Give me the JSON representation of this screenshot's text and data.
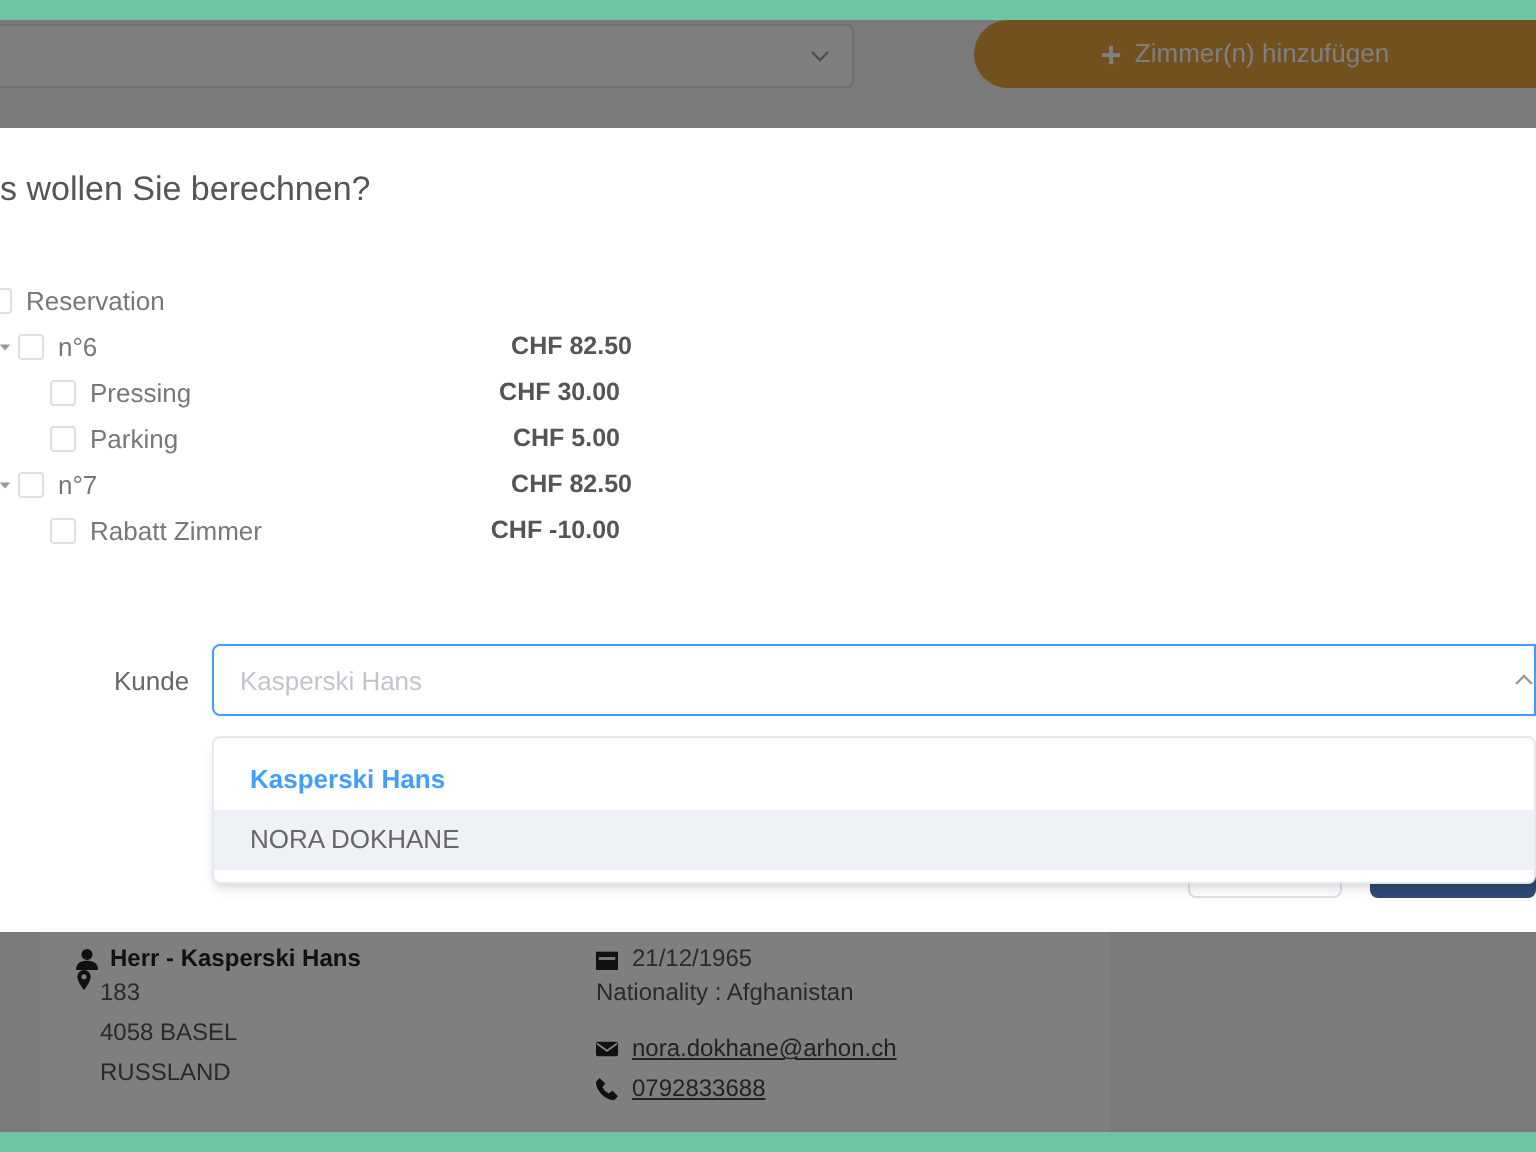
{
  "background": {
    "add_button": {
      "label": "Zimmer(n) hinzufügen"
    },
    "customer_card": {
      "name": "Herr - Kasperski Hans",
      "address": [
        "183",
        "4058 BASEL",
        "RUSSLAND"
      ],
      "birthdate": "21/12/1965",
      "nationality": "Nationality : Afghanistan",
      "email": "nora.dokhane@arhon.ch",
      "phone": "0792833688"
    }
  },
  "dialog": {
    "title": "s wollen Sie berechnen?",
    "tree": [
      {
        "label": "Reservation",
        "checked": false,
        "children": [
          {
            "label": "n°6",
            "price": "CHF 82.50",
            "checked": false,
            "expanded": true,
            "children": [
              {
                "label": "Pressing",
                "price": "CHF 30.00",
                "checked": false
              },
              {
                "label": "Parking",
                "price": "CHF 5.00",
                "checked": false
              }
            ]
          },
          {
            "label": "n°7",
            "price": "CHF 82.50",
            "checked": false,
            "expanded": true,
            "children": [
              {
                "label": "Rabatt Zimmer",
                "price": "CHF -10.00",
                "checked": false
              }
            ]
          }
        ]
      }
    ],
    "customer_label": "Kunde",
    "customer_field": {
      "placeholder": "Kasperski Hans"
    },
    "dropdown": [
      {
        "label": "Kasperski Hans",
        "selected": true,
        "highlighted": false
      },
      {
        "label": "NORA DOKHANE",
        "selected": false,
        "highlighted": true
      }
    ]
  }
}
